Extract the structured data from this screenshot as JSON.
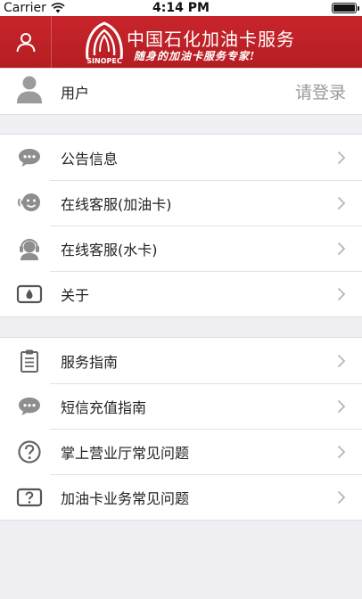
{
  "status_bar": {
    "carrier": "Carrier",
    "time": "4:14 PM"
  },
  "header": {
    "title": "中国石化加油卡服务",
    "slogan": "随身的加油卡服务专家!",
    "logo_wordmark": "SINOPEC",
    "brand_color": "#c8252b"
  },
  "account": {
    "label": "用户",
    "login_label": "请登录"
  },
  "menu_group_1": [
    {
      "label": "公告信息",
      "icon": "speech-bubble-icon"
    },
    {
      "label": "在线客服(加油卡)",
      "icon": "support-agent-icon"
    },
    {
      "label": "在线客服(水卡)",
      "icon": "headset-agent-icon"
    },
    {
      "label": "关于",
      "icon": "water-drop-icon"
    }
  ],
  "menu_group_2": [
    {
      "label": "服务指南",
      "icon": "clipboard-icon"
    },
    {
      "label": "短信充值指南",
      "icon": "sms-bubble-icon"
    },
    {
      "label": "掌上营业厅常见问题",
      "icon": "question-circle-icon"
    },
    {
      "label": "加油卡业务常见问题",
      "icon": "question-box-icon"
    }
  ]
}
